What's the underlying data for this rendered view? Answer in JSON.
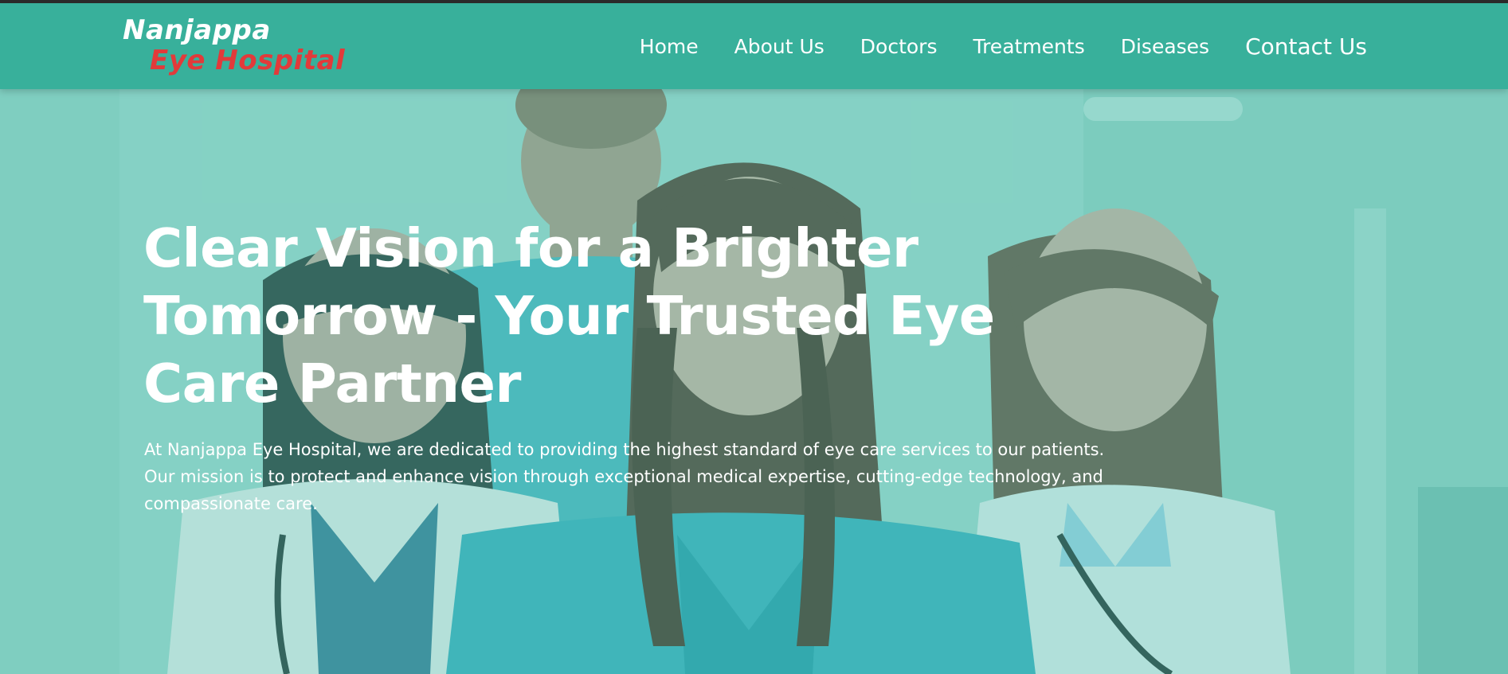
{
  "logo": {
    "line1": "Nanjappa",
    "line2": "Eye Hospital",
    "colors": {
      "line1": "#ffffff",
      "line2": "#e23a3a"
    }
  },
  "nav": {
    "items": [
      {
        "label": "Home"
      },
      {
        "label": "About Us"
      },
      {
        "label": "Doctors"
      },
      {
        "label": "Treatments"
      },
      {
        "label": "Diseases"
      },
      {
        "label": "Contact Us"
      }
    ]
  },
  "hero": {
    "title": "Clear Vision for a Brighter Tomorrow - Your Trusted Eye Care Partner",
    "description": "At Nanjappa Eye Hospital, we are dedicated to providing the highest standard of eye care services to our patients. Our mission is to protect and enhance vision through exceptional medical expertise, cutting-edge technology, and compassionate care.",
    "background": "photo-of-medical-team"
  },
  "colors": {
    "navbar": "#38b09b",
    "overlay": "#46beaa",
    "text": "#ffffff",
    "brand_red": "#e23a3a"
  }
}
